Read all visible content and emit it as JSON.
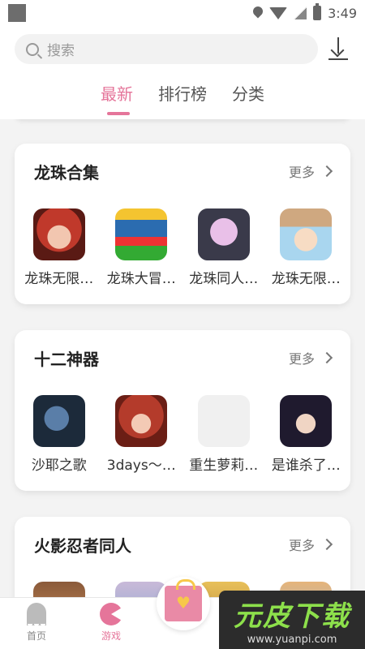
{
  "status_bar": {
    "time": "3:49"
  },
  "search": {
    "placeholder": "搜索"
  },
  "tabs": [
    {
      "label": "最新"
    },
    {
      "label": "排行榜"
    },
    {
      "label": "分类"
    }
  ],
  "sections": [
    {
      "title": "龙珠合集",
      "more": "更多",
      "games": [
        {
          "name": "龙珠无限…",
          "icon": "red-haired-girl-icon"
        },
        {
          "name": "龙珠大冒…",
          "icon": "dragon-ball-logo-icon"
        },
        {
          "name": "龙珠同人…",
          "icon": "android-girl-icon"
        },
        {
          "name": "龙珠无限…",
          "icon": "girl-with-hat-icon"
        }
      ]
    },
    {
      "title": "十二神器",
      "more": "更多",
      "games": [
        {
          "name": "沙耶之歌",
          "icon": "saya-no-uta-icon"
        },
        {
          "name": "3days～…",
          "icon": "red-haired-anime-girl-icon"
        },
        {
          "name": "重生萝莉…",
          "icon": "placeholder-icon"
        },
        {
          "name": "是谁杀了…",
          "icon": "dark-haired-girl-icon"
        }
      ]
    },
    {
      "title": "火影忍者同人",
      "more": "更多",
      "games": []
    }
  ],
  "bottom_nav": {
    "home": "首页",
    "game": "游戏"
  },
  "watermark": {
    "main": "元皮下载",
    "url": "www.yuanpi.com"
  },
  "colors": {
    "accent": "#e5759a"
  }
}
